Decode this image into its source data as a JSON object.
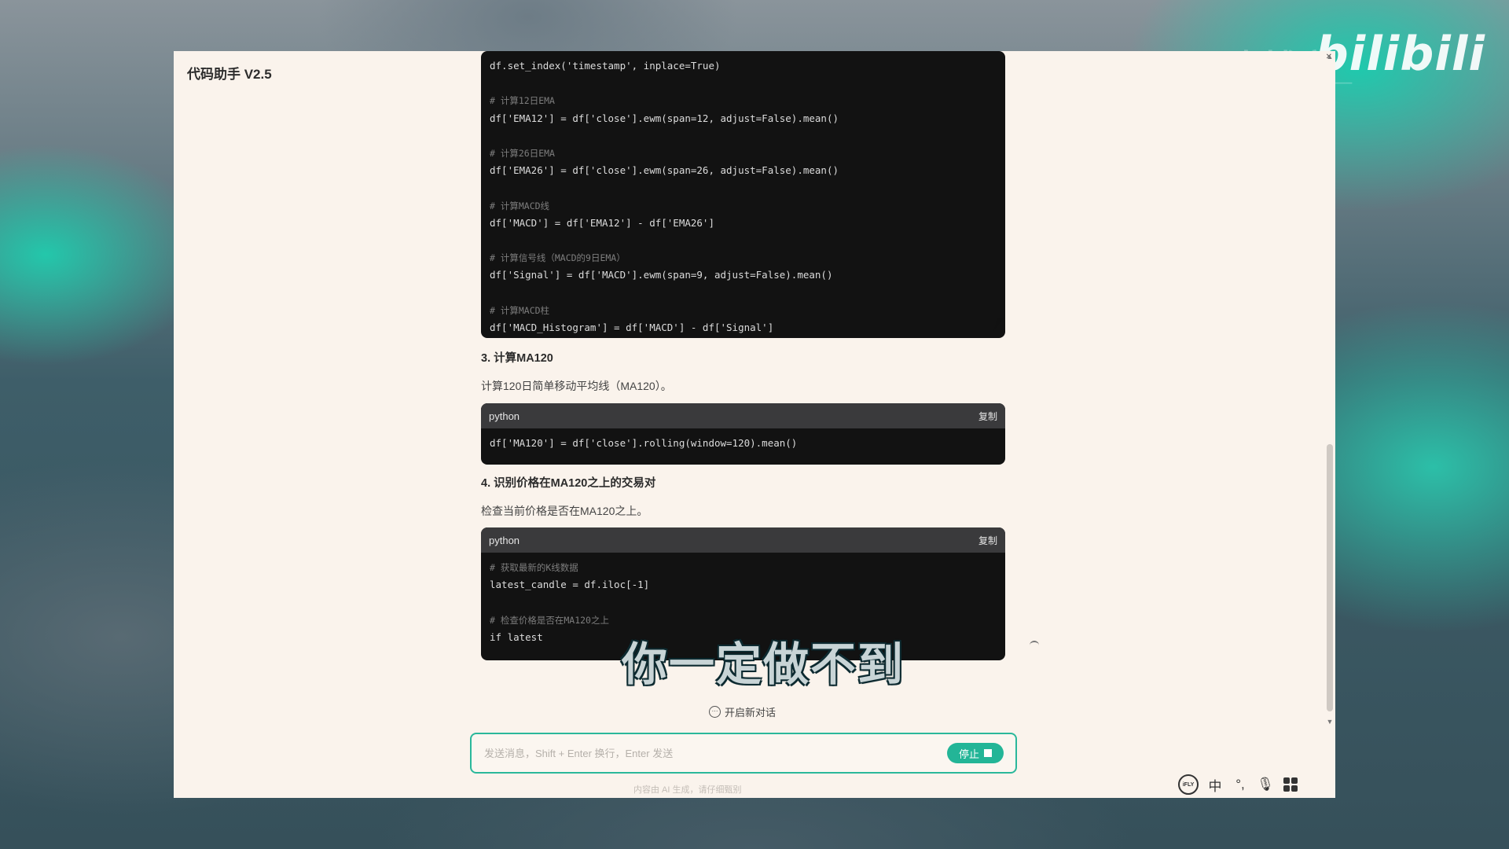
{
  "app": {
    "title": "代码助手 V2.5"
  },
  "watermark": {
    "logo_text": "bilibili",
    "ghost_text": "图表博客_"
  },
  "code_block_1": {
    "lines": [
      {
        "text": "df.set_index('timestamp', inplace=True)",
        "type": "code"
      },
      {
        "text": "",
        "type": "blank"
      },
      {
        "text": "# 计算12日EMA",
        "type": "comment"
      },
      {
        "text": "df['EMA12'] = df['close'].ewm(span=12, adjust=False).mean()",
        "type": "code"
      },
      {
        "text": "",
        "type": "blank"
      },
      {
        "text": "# 计算26日EMA",
        "type": "comment"
      },
      {
        "text": "df['EMA26'] = df['close'].ewm(span=26, adjust=False).mean()",
        "type": "code"
      },
      {
        "text": "",
        "type": "blank"
      },
      {
        "text": "# 计算MACD线",
        "type": "comment"
      },
      {
        "text": "df['MACD'] = df['EMA12'] - df['EMA26']",
        "type": "code"
      },
      {
        "text": "",
        "type": "blank"
      },
      {
        "text": "# 计算信号线（MACD的9日EMA）",
        "type": "comment"
      },
      {
        "text": "df['Signal'] = df['MACD'].ewm(span=9, adjust=False).mean()",
        "type": "code"
      },
      {
        "text": "",
        "type": "blank"
      },
      {
        "text": "# 计算MACD柱",
        "type": "comment"
      },
      {
        "text": "df['MACD_Histogram'] = df['MACD'] - df['Signal']",
        "type": "code"
      }
    ]
  },
  "section_3": {
    "heading": "3. 计算MA120",
    "description": "计算120日简单移动平均线（MA120）。"
  },
  "code_block_2": {
    "lang": "python",
    "copy_label": "复制",
    "lines": [
      {
        "text": "df['MA120'] = df['close'].rolling(window=120).mean()",
        "type": "code"
      }
    ]
  },
  "section_4": {
    "heading": "4. 识别价格在MA120之上的交易对",
    "description": "检查当前价格是否在MA120之上。"
  },
  "code_block_3": {
    "lang": "python",
    "copy_label": "复制",
    "lines": [
      {
        "text": "# 获取最新的K线数据",
        "type": "comment"
      },
      {
        "text": "latest_candle = df.iloc[-1]",
        "type": "code"
      },
      {
        "text": "",
        "type": "blank"
      },
      {
        "text": "# 检查价格是否在MA120之上",
        "type": "comment"
      },
      {
        "text": "if latest",
        "type": "code"
      }
    ]
  },
  "video_subtitle": "你一定做不到",
  "new_chat": {
    "label": "开启新对话"
  },
  "input": {
    "placeholder": "发送消息，Shift + Enter 换行，Enter 发送",
    "value": ""
  },
  "send_button": {
    "label": "停止"
  },
  "footer_note": "内容由 AI 生成，请仔细甄别",
  "ime_toolbar": {
    "logo_text": "iFLY",
    "lang_label": "中",
    "punct_label": "°,"
  }
}
